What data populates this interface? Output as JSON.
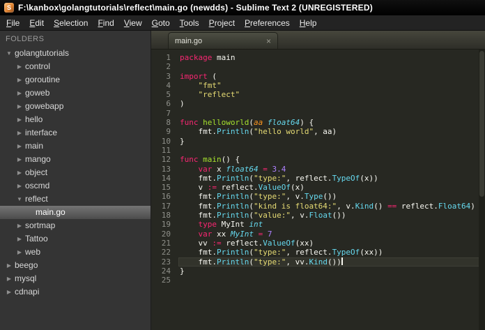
{
  "window": {
    "title": "F:\\kanbox\\golangtutorials\\reflect\\main.go (newdds) - Sublime Text 2 (UNREGISTERED)",
    "app_icon_letter": "S"
  },
  "menu": {
    "items": [
      "File",
      "Edit",
      "Selection",
      "Find",
      "View",
      "Goto",
      "Tools",
      "Project",
      "Preferences",
      "Help"
    ]
  },
  "sidebar": {
    "header": "FOLDERS",
    "items": [
      {
        "label": "golangtutorials",
        "depth": 0,
        "type": "folder",
        "expanded": true,
        "selected": false
      },
      {
        "label": "control",
        "depth": 1,
        "type": "folder",
        "expanded": false,
        "selected": false
      },
      {
        "label": "goroutine",
        "depth": 1,
        "type": "folder",
        "expanded": false,
        "selected": false
      },
      {
        "label": "goweb",
        "depth": 1,
        "type": "folder",
        "expanded": false,
        "selected": false
      },
      {
        "label": "gowebapp",
        "depth": 1,
        "type": "folder",
        "expanded": false,
        "selected": false
      },
      {
        "label": "hello",
        "depth": 1,
        "type": "folder",
        "expanded": false,
        "selected": false
      },
      {
        "label": "interface",
        "depth": 1,
        "type": "folder",
        "expanded": false,
        "selected": false
      },
      {
        "label": "main",
        "depth": 1,
        "type": "folder",
        "expanded": false,
        "selected": false
      },
      {
        "label": "mango",
        "depth": 1,
        "type": "folder",
        "expanded": false,
        "selected": false
      },
      {
        "label": "object",
        "depth": 1,
        "type": "folder",
        "expanded": false,
        "selected": false
      },
      {
        "label": "oscmd",
        "depth": 1,
        "type": "folder",
        "expanded": false,
        "selected": false
      },
      {
        "label": "reflect",
        "depth": 1,
        "type": "folder",
        "expanded": true,
        "selected": false
      },
      {
        "label": "main.go",
        "depth": 2,
        "type": "file",
        "expanded": false,
        "selected": true
      },
      {
        "label": "sortmap",
        "depth": 1,
        "type": "folder",
        "expanded": false,
        "selected": false
      },
      {
        "label": "Tattoo",
        "depth": 1,
        "type": "folder",
        "expanded": false,
        "selected": false
      },
      {
        "label": "web",
        "depth": 1,
        "type": "folder",
        "expanded": false,
        "selected": false
      },
      {
        "label": "beego",
        "depth": 0,
        "type": "folder",
        "expanded": false,
        "selected": false
      },
      {
        "label": "mysql",
        "depth": 0,
        "type": "folder",
        "expanded": false,
        "selected": false
      },
      {
        "label": "cdnapi",
        "depth": 0,
        "type": "folder",
        "expanded": false,
        "selected": false
      }
    ]
  },
  "editor": {
    "tab": {
      "label": "main.go",
      "close": "×"
    },
    "code": {
      "language": "go",
      "current_line": 23,
      "lines": [
        {
          "n": 1,
          "t": [
            [
              "k",
              "package"
            ],
            [
              "p",
              " main"
            ]
          ]
        },
        {
          "n": 2,
          "t": []
        },
        {
          "n": 3,
          "t": [
            [
              "k",
              "import"
            ],
            [
              "p",
              " ("
            ]
          ]
        },
        {
          "n": 4,
          "t": [
            [
              "p",
              "    "
            ],
            [
              "s",
              "\"fmt\""
            ]
          ]
        },
        {
          "n": 5,
          "t": [
            [
              "p",
              "    "
            ],
            [
              "s",
              "\"reflect\""
            ]
          ]
        },
        {
          "n": 6,
          "t": [
            [
              "p",
              ")"
            ]
          ]
        },
        {
          "n": 7,
          "t": []
        },
        {
          "n": 8,
          "t": [
            [
              "k",
              "func"
            ],
            [
              "p",
              " "
            ],
            [
              "g",
              "helloworld"
            ],
            [
              "p",
              "("
            ],
            [
              "a",
              "aa"
            ],
            [
              "p",
              " "
            ],
            [
              "t",
              "float64"
            ],
            [
              "p",
              ") {"
            ]
          ]
        },
        {
          "n": 9,
          "t": [
            [
              "p",
              "    fmt."
            ],
            [
              "f",
              "Println"
            ],
            [
              "p",
              "("
            ],
            [
              "s",
              "\"hello world\""
            ],
            [
              "p",
              ", aa)"
            ]
          ]
        },
        {
          "n": 10,
          "t": [
            [
              "p",
              "}"
            ]
          ]
        },
        {
          "n": 11,
          "t": []
        },
        {
          "n": 12,
          "t": [
            [
              "k",
              "func"
            ],
            [
              "p",
              " "
            ],
            [
              "g",
              "main"
            ],
            [
              "p",
              "() {"
            ]
          ]
        },
        {
          "n": 13,
          "t": [
            [
              "p",
              "    "
            ],
            [
              "k",
              "var"
            ],
            [
              "p",
              " x "
            ],
            [
              "t",
              "float64"
            ],
            [
              "p",
              " "
            ],
            [
              "o",
              "="
            ],
            [
              "p",
              " "
            ],
            [
              "n",
              "3.4"
            ]
          ]
        },
        {
          "n": 14,
          "t": [
            [
              "p",
              "    fmt."
            ],
            [
              "f",
              "Println"
            ],
            [
              "p",
              "("
            ],
            [
              "s",
              "\"type:\""
            ],
            [
              "p",
              ", reflect."
            ],
            [
              "f",
              "TypeOf"
            ],
            [
              "p",
              "(x))"
            ]
          ]
        },
        {
          "n": 15,
          "t": [
            [
              "p",
              "    v "
            ],
            [
              "o",
              ":="
            ],
            [
              "p",
              " reflect."
            ],
            [
              "f",
              "ValueOf"
            ],
            [
              "p",
              "(x)"
            ]
          ]
        },
        {
          "n": 16,
          "t": [
            [
              "p",
              "    fmt."
            ],
            [
              "f",
              "Println"
            ],
            [
              "p",
              "("
            ],
            [
              "s",
              "\"type:\""
            ],
            [
              "p",
              ", v."
            ],
            [
              "f",
              "Type"
            ],
            [
              "p",
              "())"
            ]
          ]
        },
        {
          "n": 17,
          "t": [
            [
              "p",
              "    fmt."
            ],
            [
              "f",
              "Println"
            ],
            [
              "p",
              "("
            ],
            [
              "s",
              "\"kind is float64:\""
            ],
            [
              "p",
              ", v."
            ],
            [
              "f",
              "Kind"
            ],
            [
              "p",
              "() "
            ],
            [
              "o",
              "=="
            ],
            [
              "p",
              " reflect."
            ],
            [
              "f",
              "Float64"
            ],
            [
              "p",
              ")"
            ]
          ]
        },
        {
          "n": 18,
          "t": [
            [
              "p",
              "    fmt."
            ],
            [
              "f",
              "Println"
            ],
            [
              "p",
              "("
            ],
            [
              "s",
              "\"value:\""
            ],
            [
              "p",
              ", v."
            ],
            [
              "f",
              "Float"
            ],
            [
              "p",
              "())"
            ]
          ]
        },
        {
          "n": 19,
          "t": [
            [
              "p",
              "    "
            ],
            [
              "k",
              "type"
            ],
            [
              "p",
              " MyInt "
            ],
            [
              "t",
              "int"
            ]
          ]
        },
        {
          "n": 20,
          "t": [
            [
              "p",
              "    "
            ],
            [
              "k",
              "var"
            ],
            [
              "p",
              " xx "
            ],
            [
              "t",
              "MyInt"
            ],
            [
              "p",
              " "
            ],
            [
              "o",
              "="
            ],
            [
              "p",
              " "
            ],
            [
              "n",
              "7"
            ]
          ]
        },
        {
          "n": 21,
          "t": [
            [
              "p",
              "    vv "
            ],
            [
              "o",
              ":="
            ],
            [
              "p",
              " reflect."
            ],
            [
              "f",
              "ValueOf"
            ],
            [
              "p",
              "(xx)"
            ]
          ]
        },
        {
          "n": 22,
          "t": [
            [
              "p",
              "    fmt."
            ],
            [
              "f",
              "Println"
            ],
            [
              "p",
              "("
            ],
            [
              "s",
              "\"type:\""
            ],
            [
              "p",
              ", reflect."
            ],
            [
              "f",
              "TypeOf"
            ],
            [
              "p",
              "(xx))"
            ]
          ]
        },
        {
          "n": 23,
          "t": [
            [
              "p",
              "    fmt."
            ],
            [
              "f",
              "Println"
            ],
            [
              "p",
              "("
            ],
            [
              "s",
              "\"type:\""
            ],
            [
              "p",
              ", vv."
            ],
            [
              "f",
              "Kind"
            ],
            [
              "p",
              "())"
            ]
          ]
        },
        {
          "n": 24,
          "t": [
            [
              "p",
              "}"
            ]
          ]
        },
        {
          "n": 25,
          "t": []
        }
      ]
    }
  },
  "colors": {
    "editor_bg": "#272822",
    "sidebar_bg": "#343434",
    "keyword": "#F92672",
    "string": "#E6DB74",
    "number": "#AE81FF",
    "type_italic": "#66D9EF",
    "function_def": "#A6E22E",
    "parameter": "#FD971F",
    "plain_text": "#F8F8F2",
    "line_number": "#8F908A"
  }
}
